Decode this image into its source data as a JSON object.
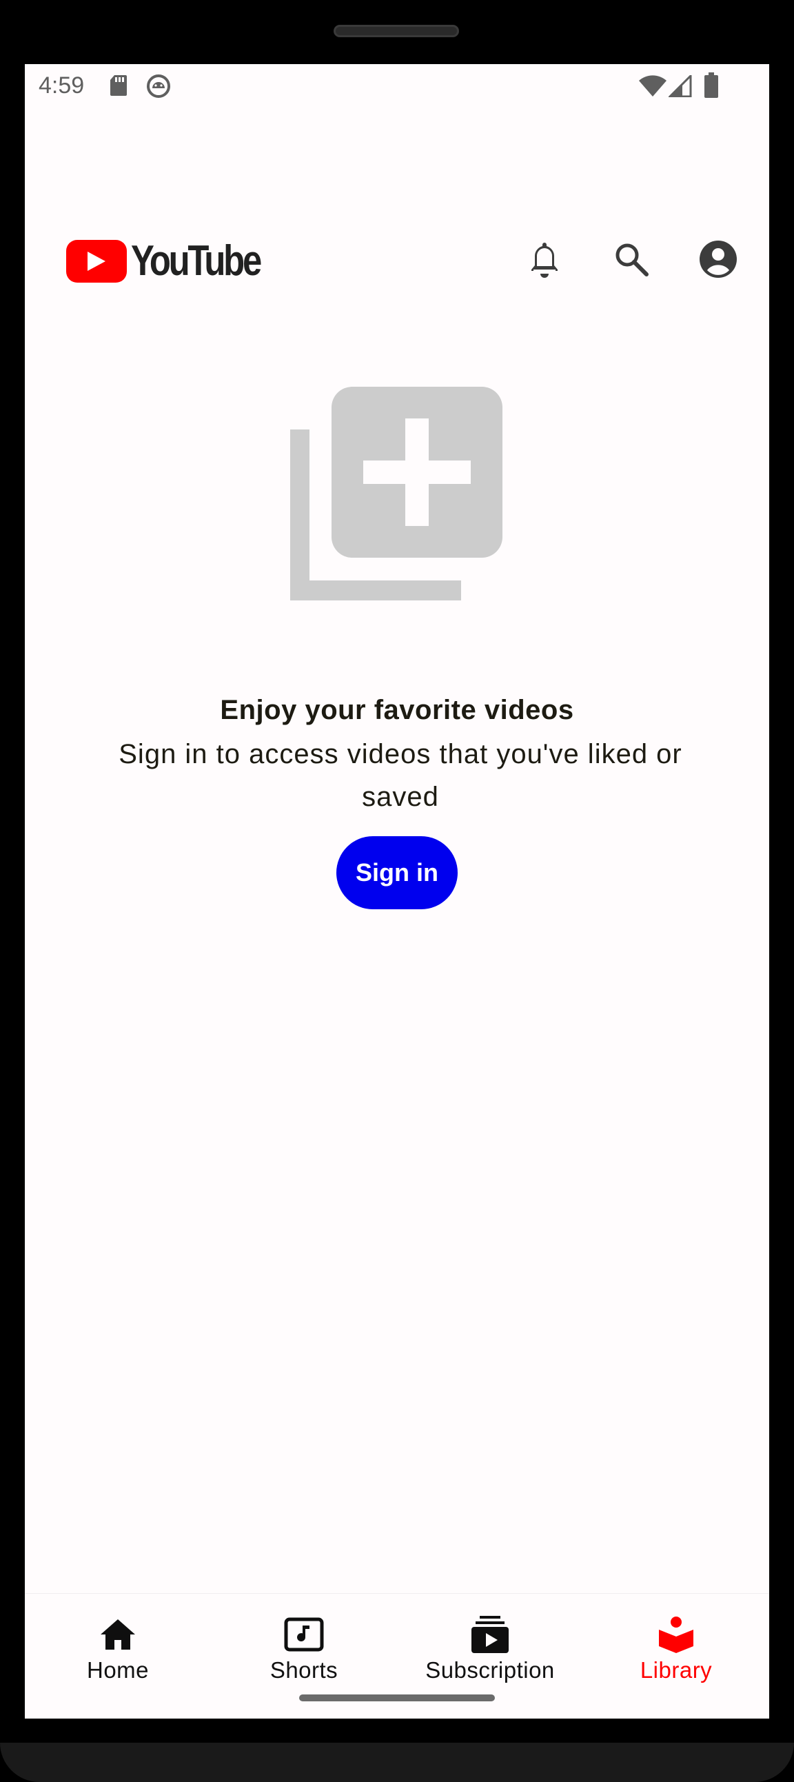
{
  "status_bar": {
    "time": "4:59",
    "left_icons": [
      "sd-card-icon",
      "android-debug-icon"
    ],
    "right_icons": [
      "wifi-icon",
      "cell-signal-icon",
      "battery-icon"
    ]
  },
  "header": {
    "logo_text": "YouTube",
    "brand_color": "#ff0000",
    "actions": [
      "bell-icon",
      "search-icon",
      "account-icon"
    ]
  },
  "empty_state": {
    "icon": "add-to-library-icon",
    "title": "Enjoy your favorite videos",
    "subtitle": "Sign in to access videos that you've liked or saved",
    "button_label": "Sign in",
    "button_color": "#0000ee"
  },
  "bottom_nav": {
    "items": [
      {
        "label": "Home",
        "icon": "home-icon",
        "active": false
      },
      {
        "label": "Shorts",
        "icon": "shorts-icon",
        "active": false
      },
      {
        "label": "Subscription",
        "icon": "subscriptions-icon",
        "active": false
      },
      {
        "label": "Library",
        "icon": "library-icon",
        "active": true
      }
    ],
    "active_color": "#ff0000"
  }
}
